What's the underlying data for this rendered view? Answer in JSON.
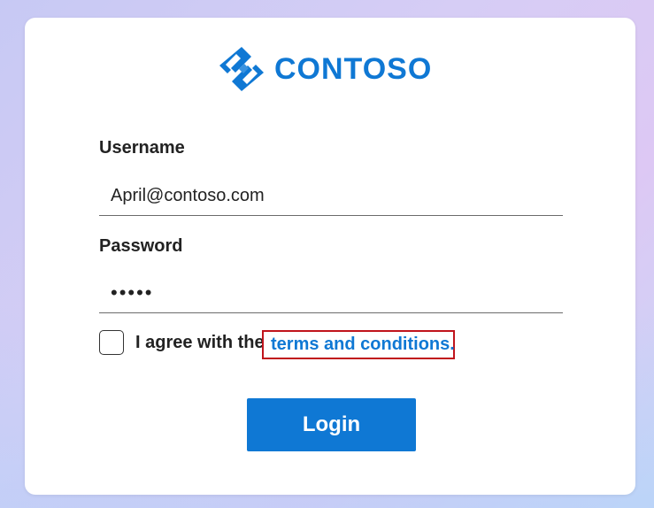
{
  "brand": {
    "name": "CONTOSO",
    "logo_icon": "contoso-logo-icon",
    "color": "#0f78d4"
  },
  "form": {
    "username": {
      "label": "Username",
      "value": "April@contoso.com"
    },
    "password": {
      "label": "Password",
      "value": "•••••"
    },
    "agree": {
      "text": "I agree with the",
      "link_text": "terms and conditions.",
      "checked": false
    },
    "login_label": "Login"
  },
  "colors": {
    "accent": "#0f78d4",
    "highlight_border": "#c0141c"
  }
}
